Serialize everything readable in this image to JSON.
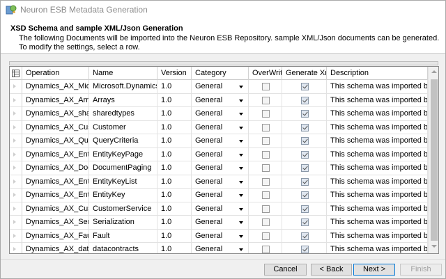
{
  "window": {
    "title": "Neuron ESB Metadata Generation"
  },
  "header": {
    "title": "XSD Schema and sample XML/Json Generation",
    "description": "The following Documents will be imported into the Neuron ESB Repository. sample XML/Json documents can be generated. To modify the settings, select a row."
  },
  "grid": {
    "columns": [
      "Operation",
      "Name",
      "Version",
      "Category",
      "OverWrit",
      "Generate Xm",
      "Description"
    ],
    "rows": [
      {
        "operation": "Dynamics_AX_Micros",
        "name": "Microsoft.Dynamics.A",
        "version": "1.0",
        "category": "General",
        "overwrite": false,
        "generate": true,
        "description": "This schema was imported by th"
      },
      {
        "operation": "Dynamics_AX_Arrays",
        "name": "Arrays",
        "version": "1.0",
        "category": "General",
        "overwrite": false,
        "generate": true,
        "description": "This schema was imported by th"
      },
      {
        "operation": "Dynamics_AX_shared",
        "name": "sharedtypes",
        "version": "1.0",
        "category": "General",
        "overwrite": false,
        "generate": true,
        "description": "This schema was imported by th"
      },
      {
        "operation": "Dynamics_AX_Custor",
        "name": "Customer",
        "version": "1.0",
        "category": "General",
        "overwrite": false,
        "generate": true,
        "description": "This schema was imported by th"
      },
      {
        "operation": "Dynamics_AX_QueryC",
        "name": "QueryCriteria",
        "version": "1.0",
        "category": "General",
        "overwrite": false,
        "generate": true,
        "description": "This schema was imported by th"
      },
      {
        "operation": "Dynamics_AX_EntityK",
        "name": "EntityKeyPage",
        "version": "1.0",
        "category": "General",
        "overwrite": false,
        "generate": true,
        "description": "This schema was imported by th"
      },
      {
        "operation": "Dynamics_AX_Docum",
        "name": "DocumentPaging",
        "version": "1.0",
        "category": "General",
        "overwrite": false,
        "generate": true,
        "description": "This schema was imported by th"
      },
      {
        "operation": "Dynamics_AX_EntityK",
        "name": "EntityKeyList",
        "version": "1.0",
        "category": "General",
        "overwrite": false,
        "generate": true,
        "description": "This schema was imported by th"
      },
      {
        "operation": "Dynamics_AX_EntityK",
        "name": "EntityKey",
        "version": "1.0",
        "category": "General",
        "overwrite": false,
        "generate": true,
        "description": "This schema was imported by th"
      },
      {
        "operation": "Dynamics_AX_Custor",
        "name": "CustomerService",
        "version": "1.0",
        "category": "General",
        "overwrite": false,
        "generate": true,
        "description": "This schema was imported by th"
      },
      {
        "operation": "Dynamics_AX_Serializ",
        "name": "Serialization",
        "version": "1.0",
        "category": "General",
        "overwrite": false,
        "generate": true,
        "description": "This schema was imported by th"
      },
      {
        "operation": "Dynamics_AX_Fault",
        "name": "Fault",
        "version": "1.0",
        "category": "General",
        "overwrite": false,
        "generate": true,
        "description": "This schema was imported by th"
      },
      {
        "operation": "Dynamics_AX_dataco",
        "name": "datacontracts",
        "version": "1.0",
        "category": "General",
        "overwrite": false,
        "generate": true,
        "description": "This schema was imported by th"
      }
    ]
  },
  "buttons": {
    "cancel": "Cancel",
    "back": "< Back",
    "next": "Next >",
    "finish": "Finish"
  },
  "colors": {
    "default_button_border": "#0078d7",
    "checked_fill": "#dfe6ef"
  }
}
